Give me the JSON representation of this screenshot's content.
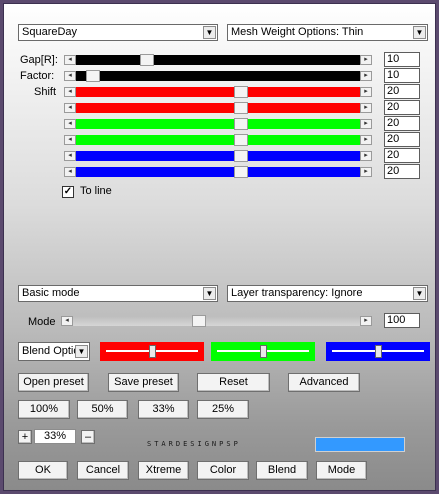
{
  "preset_select": {
    "value": "SquareDay"
  },
  "mesh_select": {
    "value": "Mesh Weight Options: Thin"
  },
  "sliders": [
    {
      "label": "Gap[R]:",
      "value": "10",
      "fill": 0.25,
      "color": "#000000"
    },
    {
      "label": "Factor:",
      "value": "10",
      "fill": 0.06,
      "color": "#000000"
    },
    {
      "label": "Shift",
      "value": "20",
      "fill": 0.58,
      "color": "#ff0000"
    },
    {
      "label": "",
      "value": "20",
      "fill": 0.58,
      "color": "#ff0000"
    },
    {
      "label": "",
      "value": "20",
      "fill": 0.58,
      "color": "#00ff00"
    },
    {
      "label": "",
      "value": "20",
      "fill": 0.58,
      "color": "#00ff00"
    },
    {
      "label": "",
      "value": "20",
      "fill": 0.58,
      "color": "#0000ff"
    },
    {
      "label": "",
      "value": "20",
      "fill": 0.58,
      "color": "#0000ff"
    }
  ],
  "to_line": {
    "label": "To line",
    "checked": true
  },
  "mode_select": {
    "value": "Basic mode"
  },
  "layer_select": {
    "value": "Layer transparency: Ignore"
  },
  "mode_slider": {
    "label": "Mode",
    "value": "100",
    "fill": 0.44
  },
  "blend_select": {
    "value": "Blend Optio"
  },
  "color_sliders": [
    {
      "color": "#ff0000",
      "level": 0.5
    },
    {
      "color": "#00ff00",
      "level": 0.5
    },
    {
      "color": "#0000ff",
      "level": 0.5
    }
  ],
  "preset_buttons": {
    "open": "Open preset",
    "save": "Save preset",
    "reset": "Reset",
    "advanced": "Advanced"
  },
  "zoom_buttons": [
    "100%",
    "50%",
    "33%",
    "25%"
  ],
  "zoom_control": {
    "plus": "+",
    "value": "33%",
    "minus": "–"
  },
  "credit": "STARDESIGNPSP",
  "swatch_color": "#3399ff",
  "bottom_buttons": [
    "OK",
    "Cancel",
    "Xtreme",
    "Color",
    "Blend",
    "Mode"
  ]
}
